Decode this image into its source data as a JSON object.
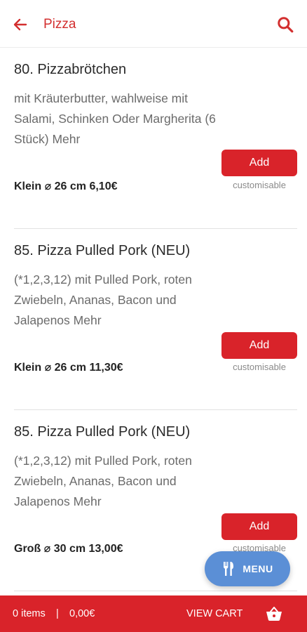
{
  "header": {
    "title": "Pizza",
    "back_icon": "arrow-left-icon",
    "search_icon": "search-icon",
    "accent_color": "#d32f2f"
  },
  "items": [
    {
      "title": "80. Pizzabrötchen",
      "description": "mit Kräuterbutter, wahlweise mit Salami, Schinken Oder Margherita (6 Stück) Mehr",
      "price": "Klein ⌀ 26 cm 6,10€",
      "add_label": "Add",
      "customisable": "customisable"
    },
    {
      "title": "85. Pizza Pulled Pork (NEU)",
      "description": "(*1,2,3,12) mit Pulled Pork, roten Zwiebeln, Ananas, Bacon und Jalapenos Mehr",
      "price": "Klein ⌀ 26 cm 11,30€",
      "add_label": "Add",
      "customisable": "customisable"
    },
    {
      "title": "85. Pizza Pulled Pork (NEU)",
      "description": "(*1,2,3,12) mit Pulled Pork, roten Zwiebeln, Ananas, Bacon und Jalapenos Mehr",
      "price": "Groß ⌀ 30 cm 13,00€",
      "add_label": "Add",
      "customisable": "customisable"
    }
  ],
  "fab": {
    "label": "MENU",
    "icon": "cutlery-icon",
    "color": "#5b8fd6"
  },
  "cart": {
    "items": "0 items",
    "separator": "|",
    "total": "0,00€",
    "view_cart": "VIEW CART",
    "icon": "basket-icon",
    "color": "#d9232a"
  }
}
